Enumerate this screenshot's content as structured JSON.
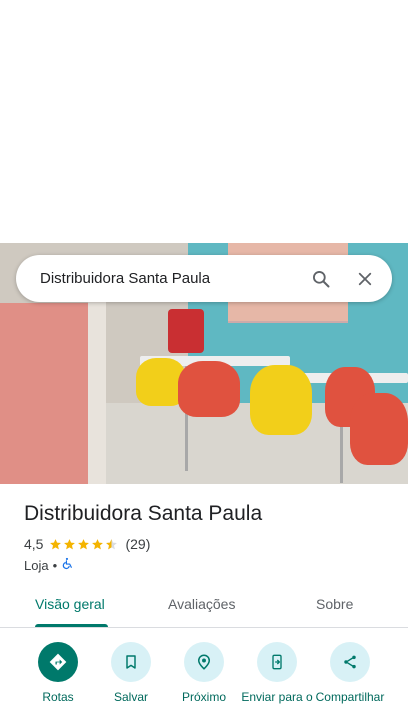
{
  "search": {
    "query": "Distribuidora Santa Paula"
  },
  "place": {
    "name": "Distribuidora Santa Paula",
    "rating": "4,5",
    "stars": 4.5,
    "reviews": "(29)",
    "category": "Loja",
    "separator": "•"
  },
  "tabs": [
    {
      "label": "Visão geral",
      "active": true
    },
    {
      "label": "Avaliações",
      "active": false
    },
    {
      "label": "Sobre",
      "active": false
    }
  ],
  "actions": [
    {
      "label": "Rotas",
      "icon": "directions-icon"
    },
    {
      "label": "Salvar",
      "icon": "bookmark-icon"
    },
    {
      "label": "Próximo",
      "icon": "nearby-icon"
    },
    {
      "label": "Enviar para o",
      "icon": "send-to-phone-icon"
    },
    {
      "label": "Compartilhar",
      "icon": "share-icon"
    }
  ],
  "colors": {
    "accent": "#00796b",
    "action_bg": "#d8f1f6",
    "star": "#f4b400"
  }
}
